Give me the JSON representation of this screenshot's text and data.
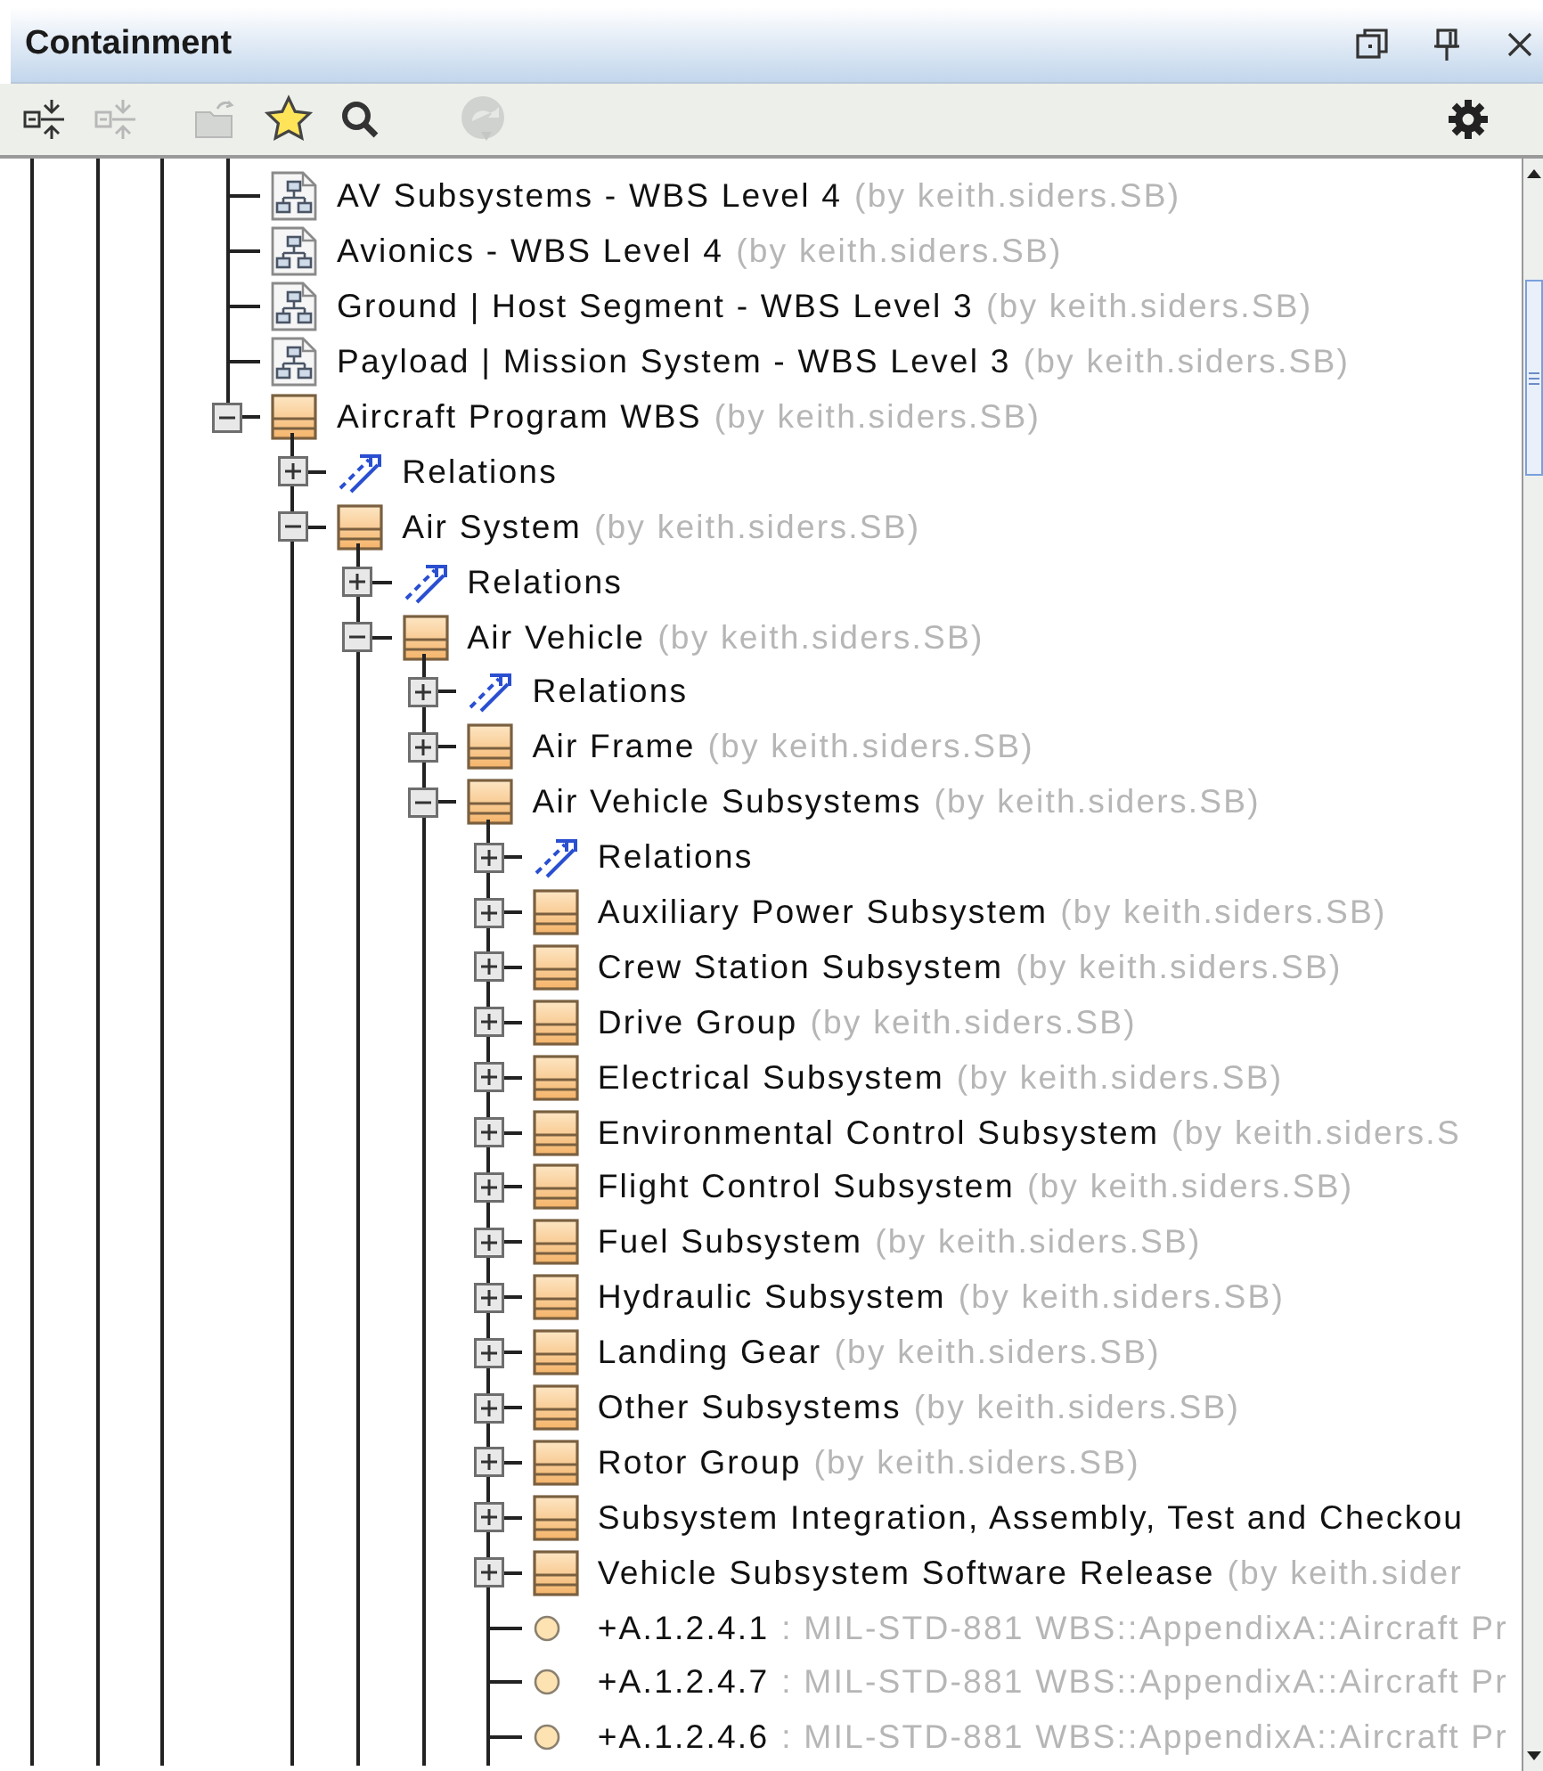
{
  "panel": {
    "title": "Containment"
  },
  "toolbar": [
    {
      "kind": "tree-arrows",
      "disabled": false
    },
    {
      "kind": "tree-arrows",
      "disabled": true
    },
    {
      "kind": "folder",
      "disabled": true
    },
    {
      "kind": "star",
      "disabled": false
    },
    {
      "kind": "search",
      "disabled": false
    },
    {
      "kind": "sync",
      "disabled": true
    },
    {
      "kind": "settings",
      "disabled": false
    }
  ],
  "tree": [
    {
      "kind": "diagram",
      "name": "AV Subsystems - WBS Level 4",
      "note": "(by keith.siders.SB)"
    },
    {
      "kind": "diagram",
      "name": "Avionics - WBS Level 4",
      "note": "(by keith.siders.SB)"
    },
    {
      "kind": "diagram",
      "name": "Ground | Host Segment - WBS Level 3",
      "note": "(by keith.siders.SB)"
    },
    {
      "kind": "diagram",
      "name": "Payload | Mission System - WBS Level 3",
      "note": "(by keith.siders.SB)"
    },
    {
      "kind": "block",
      "name": "Aircraft Program WBS",
      "note": "(by keith.siders.SB)",
      "expanded": true,
      "children": [
        {
          "kind": "relations",
          "name": "Relations",
          "expanded": false
        },
        {
          "kind": "block",
          "name": "Air System",
          "note": "(by keith.siders.SB)",
          "expanded": true,
          "continues_below": true,
          "children": [
            {
              "kind": "relations",
              "name": "Relations",
              "expanded": false
            },
            {
              "kind": "block",
              "name": "Air Vehicle",
              "note": "(by keith.siders.SB)",
              "expanded": true,
              "continues_below": true,
              "children": [
                {
                  "kind": "relations",
                  "name": "Relations",
                  "expanded": false
                },
                {
                  "kind": "block",
                  "name": "Air Frame",
                  "note": "(by keith.siders.SB)",
                  "expanded": false
                },
                {
                  "kind": "block",
                  "name": "Air Vehicle Subsystems",
                  "note": "(by keith.siders.SB)",
                  "expanded": true,
                  "continues_below": true,
                  "children": [
                    {
                      "kind": "relations",
                      "name": "Relations",
                      "expanded": false
                    },
                    {
                      "kind": "block",
                      "name": "Auxiliary Power Subsystem",
                      "note": "(by keith.siders.SB)",
                      "expanded": false
                    },
                    {
                      "kind": "block",
                      "name": "Crew Station Subsystem",
                      "note": "(by keith.siders.SB)",
                      "expanded": false
                    },
                    {
                      "kind": "block",
                      "name": "Drive Group",
                      "note": "(by keith.siders.SB)",
                      "expanded": false
                    },
                    {
                      "kind": "block",
                      "name": "Electrical Subsystem",
                      "note": "(by keith.siders.SB)",
                      "expanded": false
                    },
                    {
                      "kind": "block",
                      "name": "Environmental Control Subsystem",
                      "note": "(by keith.siders.S",
                      "expanded": false
                    },
                    {
                      "kind": "block",
                      "name": "Flight Control Subsystem",
                      "note": "(by keith.siders.SB)",
                      "expanded": false
                    },
                    {
                      "kind": "block",
                      "name": "Fuel Subsystem",
                      "note": "(by keith.siders.SB)",
                      "expanded": false
                    },
                    {
                      "kind": "block",
                      "name": "Hydraulic Subsystem",
                      "note": "(by keith.siders.SB)",
                      "expanded": false
                    },
                    {
                      "kind": "block",
                      "name": "Landing Gear",
                      "note": "(by keith.siders.SB)",
                      "expanded": false
                    },
                    {
                      "kind": "block",
                      "name": "Other Subsystems",
                      "note": "(by keith.siders.SB)",
                      "expanded": false
                    },
                    {
                      "kind": "block",
                      "name": "Rotor Group",
                      "note": "(by keith.siders.SB)",
                      "expanded": false
                    },
                    {
                      "kind": "block",
                      "name": "Subsystem Integration, Assembly, Test and Checkou",
                      "expanded": false
                    },
                    {
                      "kind": "block",
                      "name": "Vehicle Subsystem Software Release",
                      "note": "(by keith.sider",
                      "expanded": false
                    },
                    {
                      "kind": "part",
                      "name": "+A.1.2.4.1",
                      "note": ": MIL-STD-881 WBS::AppendixA::Aircraft Pr"
                    },
                    {
                      "kind": "part",
                      "name": "+A.1.2.4.7",
                      "note": ": MIL-STD-881 WBS::AppendixA::Aircraft Pr"
                    },
                    {
                      "kind": "part",
                      "name": "+A.1.2.4.6",
                      "note": ": MIL-STD-881 WBS::AppendixA::Aircraft Pr",
                      "continues_below": true
                    }
                  ]
                }
              ]
            }
          ]
        }
      ]
    }
  ]
}
